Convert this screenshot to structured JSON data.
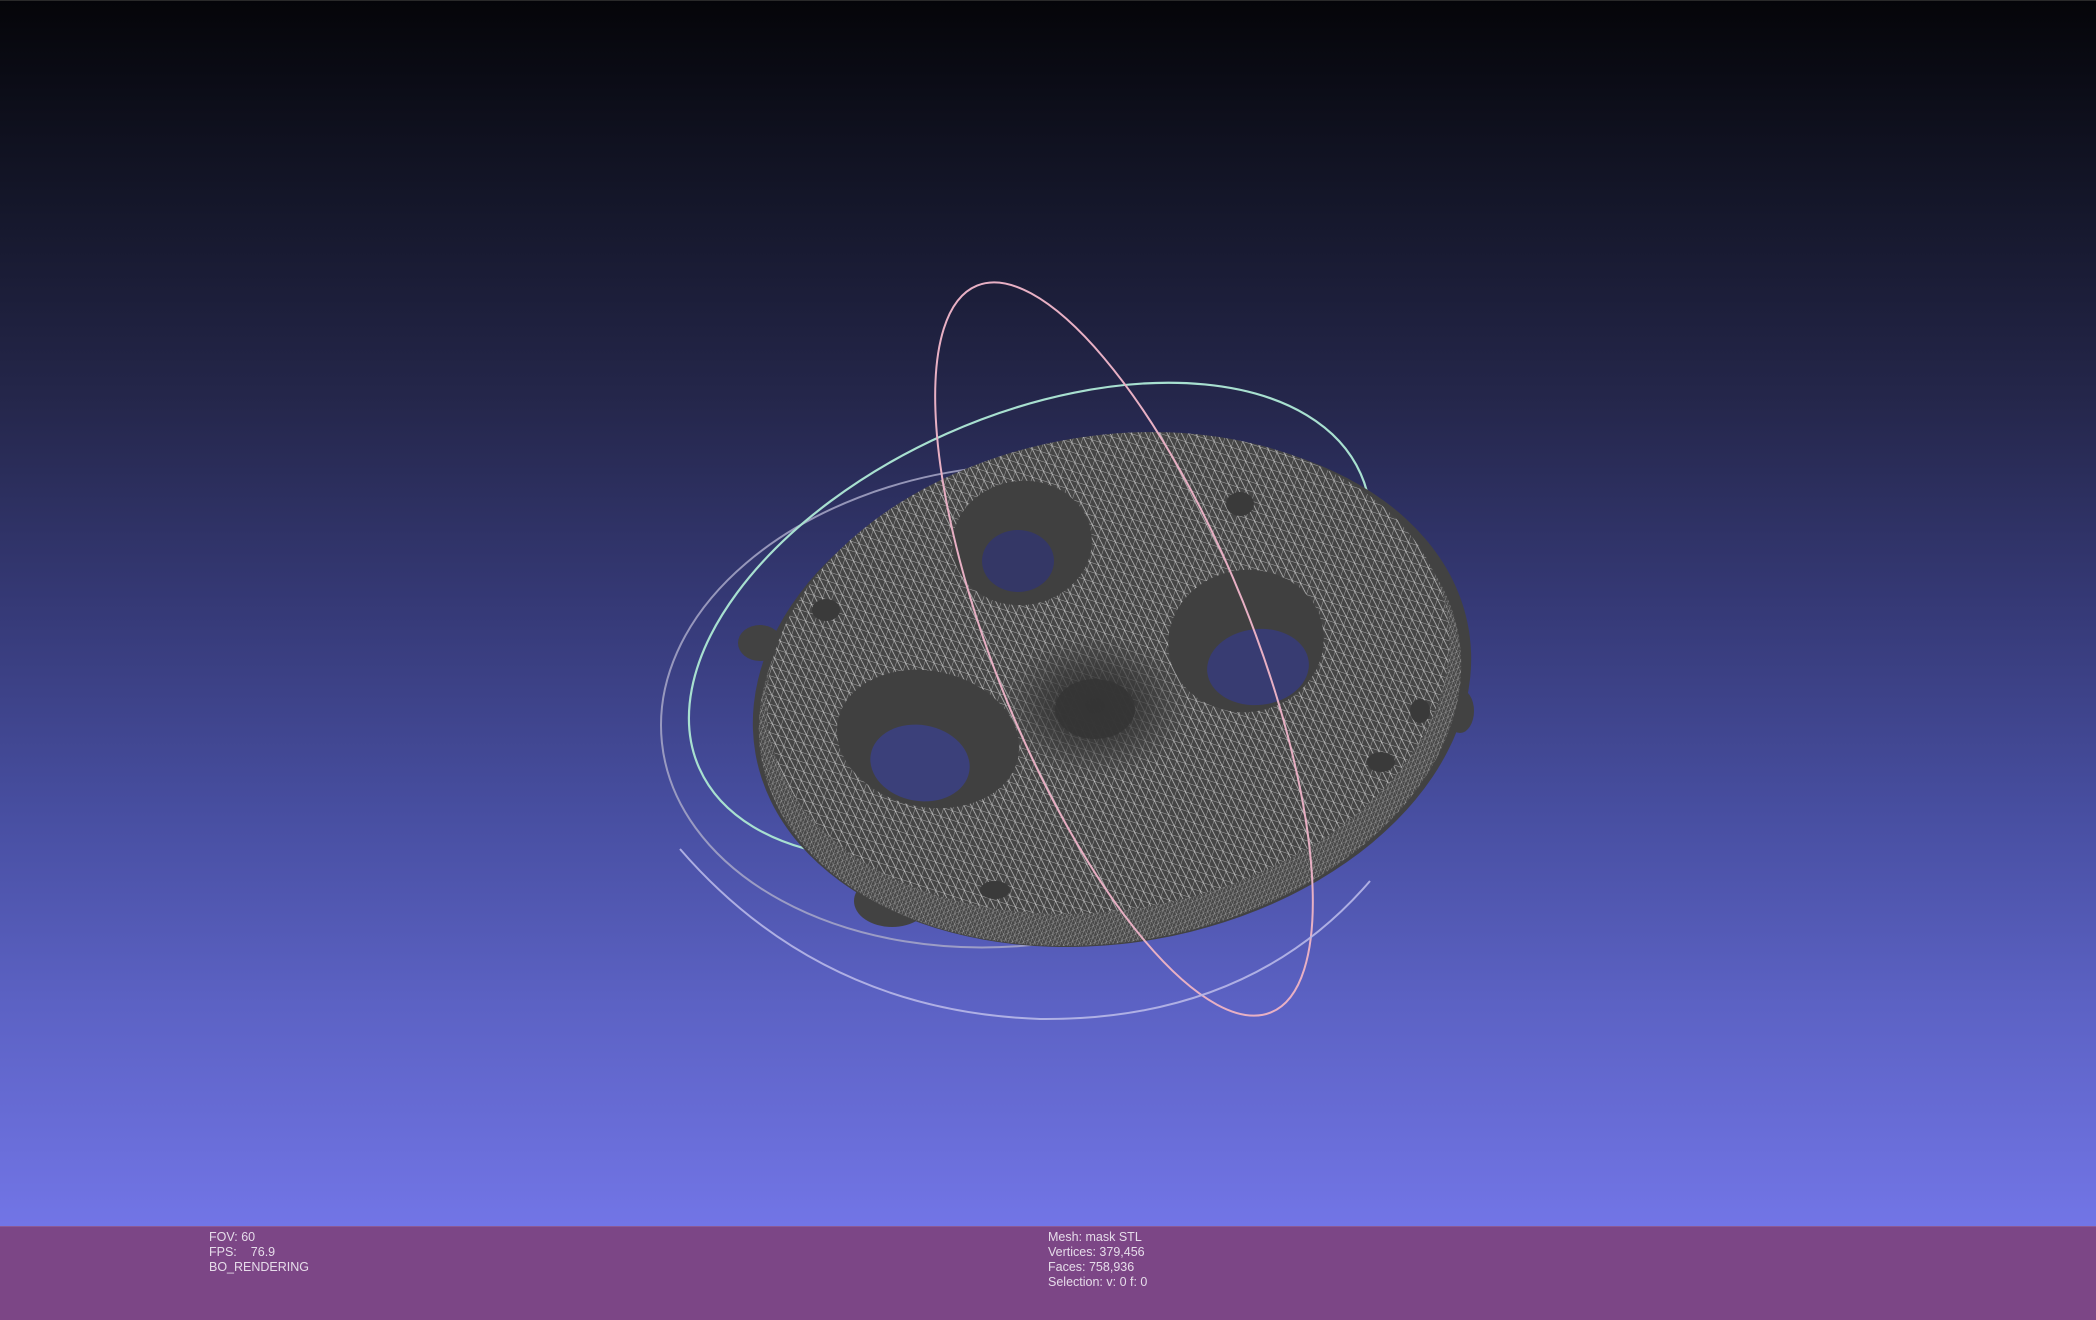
{
  "viewer": {
    "background_top": "#050509",
    "background_bottom": "#7275e6",
    "mesh_color": "#3f3f3f",
    "wireframe_color": "#cfcfcf",
    "trackball_colors": {
      "horizontal": "#a8e0d0",
      "vertical": "#e8b0c4",
      "depth": "#b8b8e8"
    }
  },
  "info_left": {
    "fov_label": "FOV:",
    "fov_value": "60",
    "fps_label": "FPS:",
    "fps_value": "76.9",
    "render_mode": "BO_RENDERING"
  },
  "info_right": {
    "mesh_line": "Mesh: mask STL",
    "vertices_line": "Vertices: 379,456",
    "faces_line": "Faces: 758,936",
    "selection_line": "Selection: v: 0 f: 0"
  }
}
